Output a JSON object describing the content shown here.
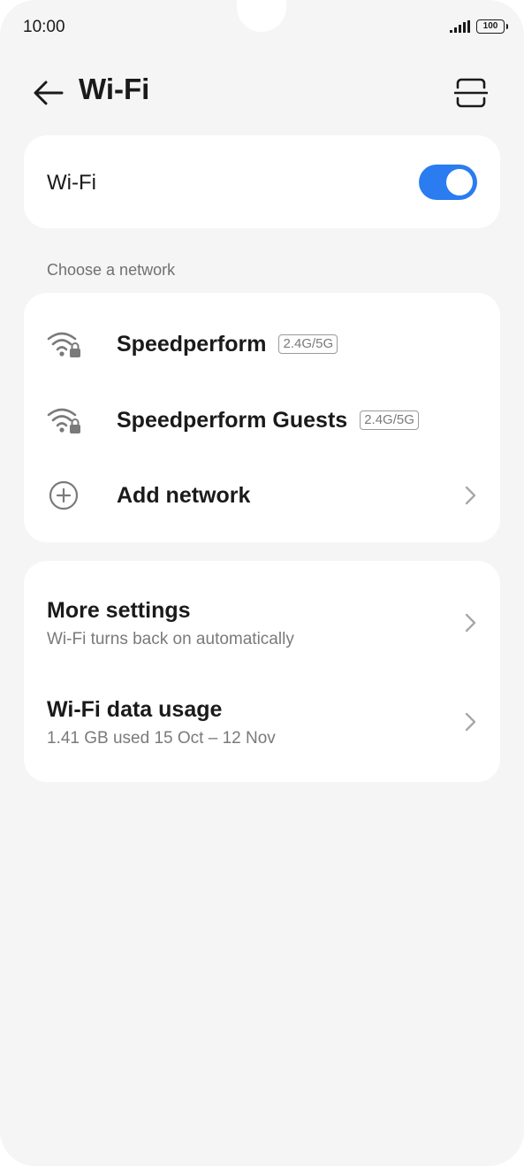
{
  "status_bar": {
    "time": "10:00",
    "battery": "100",
    "icons": [
      "signal-icon",
      "battery-icon"
    ]
  },
  "header": {
    "title": "Wi-Fi",
    "icons": [
      "back-arrow-icon",
      "scan-qr-icon"
    ]
  },
  "wifi_toggle": {
    "label": "Wi-Fi",
    "enabled": true,
    "accent_color": "#2a7cf0"
  },
  "networks": {
    "section_label": "Choose a network",
    "items": [
      {
        "name": "Speedperform",
        "band": "2.4G/5G",
        "icon": "wifi-locked-icon"
      },
      {
        "name": "Speedperform Guests",
        "band": "2.4G/5G",
        "icon": "wifi-locked-icon"
      }
    ],
    "add_network": {
      "label": "Add network",
      "icon": "add-circle-icon"
    }
  },
  "settings": {
    "items": [
      {
        "title": "More settings",
        "subtitle": "Wi-Fi turns back on automatically"
      },
      {
        "title": "Wi-Fi data usage",
        "subtitle": "1.41 GB used 15 Oct – 12 Nov"
      }
    ]
  }
}
